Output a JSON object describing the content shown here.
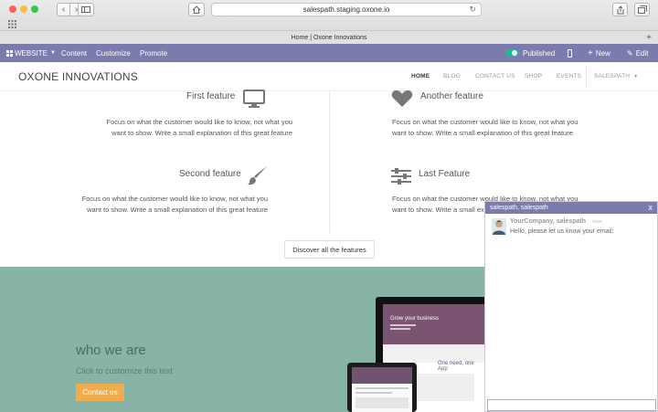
{
  "browser": {
    "url": "salespath.staging.oxone.io",
    "tab_title": "Home | Oxone Innovations"
  },
  "editor_bar": {
    "website_label": "WEBSITE",
    "content_label": "Content",
    "customize_label": "Customize",
    "promote_label": "Promote",
    "published_label": "Published",
    "new_label": "New",
    "edit_label": "Edit"
  },
  "header": {
    "brand": "OXONE INNOVATIONS",
    "nav": [
      "HOME",
      "BLOG",
      "CONTACT US",
      "SHOP",
      "EVENTS"
    ],
    "user_menu": "SALESPATH"
  },
  "features": [
    {
      "title": "First feature",
      "icon": "monitor-icon",
      "desc": "Focus on what the customer would like to know, not what you want to show. Write a small explanation of this great feature"
    },
    {
      "title": "Another feature",
      "icon": "heart-icon",
      "desc": "Focus on what the customer would like to know, not what you want to show. Write a small explanation of this great feature"
    },
    {
      "title": "Second feature",
      "icon": "paint-brush-icon",
      "desc": "Focus on what the customer would like to know, not what you want to show. Write a small explanation of this great feature"
    },
    {
      "title": "Last Feature",
      "icon": "sliders-icon",
      "desc": "Focus on what the customer would like to know, not what you want to show. Write a small explanation of this great feature"
    }
  ],
  "discover_label": "Discover all the features",
  "about": {
    "title": "who we are",
    "subtitle": "Click to customize this text",
    "contact_label": "Contact us"
  },
  "mockup": {
    "monitor_headline": "Grow your business",
    "monitor_tagline": "One need, one App"
  },
  "chat": {
    "title": "salespath, salespath",
    "close": "x",
    "author": "YourCompany, salespath",
    "time": "- now",
    "message": "Hello, please let us know your email:"
  },
  "colors": {
    "editor_bar": "#7c7bad",
    "teal_section": "#88b4a8",
    "contact_button": "#f0ad4e",
    "published_toggle": "#21b799"
  }
}
